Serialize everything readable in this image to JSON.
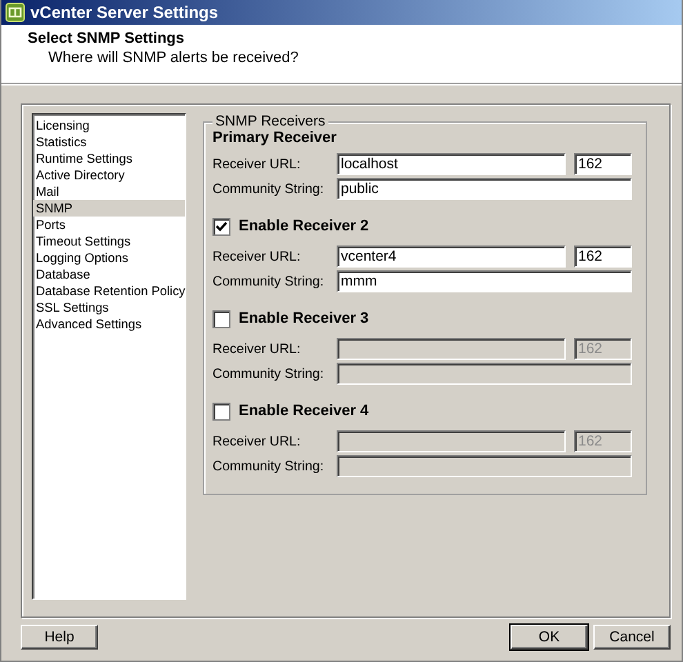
{
  "window": {
    "title": "vCenter Server Settings"
  },
  "header": {
    "title": "Select SNMP Settings",
    "subtitle": "Where will SNMP alerts be received?"
  },
  "sidebar": {
    "items": [
      {
        "label": "Licensing",
        "selected": false
      },
      {
        "label": "Statistics",
        "selected": false
      },
      {
        "label": "Runtime Settings",
        "selected": false
      },
      {
        "label": "Active Directory",
        "selected": false
      },
      {
        "label": "Mail",
        "selected": false
      },
      {
        "label": "SNMP",
        "selected": true
      },
      {
        "label": "Ports",
        "selected": false
      },
      {
        "label": "Timeout Settings",
        "selected": false
      },
      {
        "label": "Logging Options",
        "selected": false
      },
      {
        "label": "Database",
        "selected": false
      },
      {
        "label": "Database Retention Policy",
        "selected": false
      },
      {
        "label": "SSL Settings",
        "selected": false
      },
      {
        "label": "Advanced Settings",
        "selected": false
      }
    ]
  },
  "group": {
    "title": "SNMP Receivers",
    "receivers": [
      {
        "kind": "primary",
        "heading": "Primary Receiver",
        "url_label": "Receiver URL:",
        "url": "localhost",
        "port": "162",
        "community_label": "Community String:",
        "community": "public"
      },
      {
        "kind": "optional",
        "heading": "Enable Receiver 2",
        "checked": true,
        "url_label": "Receiver URL:",
        "url": "vcenter4",
        "port": "162",
        "community_label": "Community String:",
        "community": "mmm"
      },
      {
        "kind": "optional",
        "heading": "Enable Receiver 3",
        "checked": false,
        "url_label": "Receiver URL:",
        "port": "162",
        "community_label": "Community String:"
      },
      {
        "kind": "optional",
        "heading": "Enable Receiver 4",
        "checked": false,
        "url_label": "Receiver URL:",
        "port": "162",
        "community_label": "Community String:"
      }
    ]
  },
  "buttons": {
    "help": "Help",
    "ok": "OK",
    "cancel": "Cancel"
  }
}
